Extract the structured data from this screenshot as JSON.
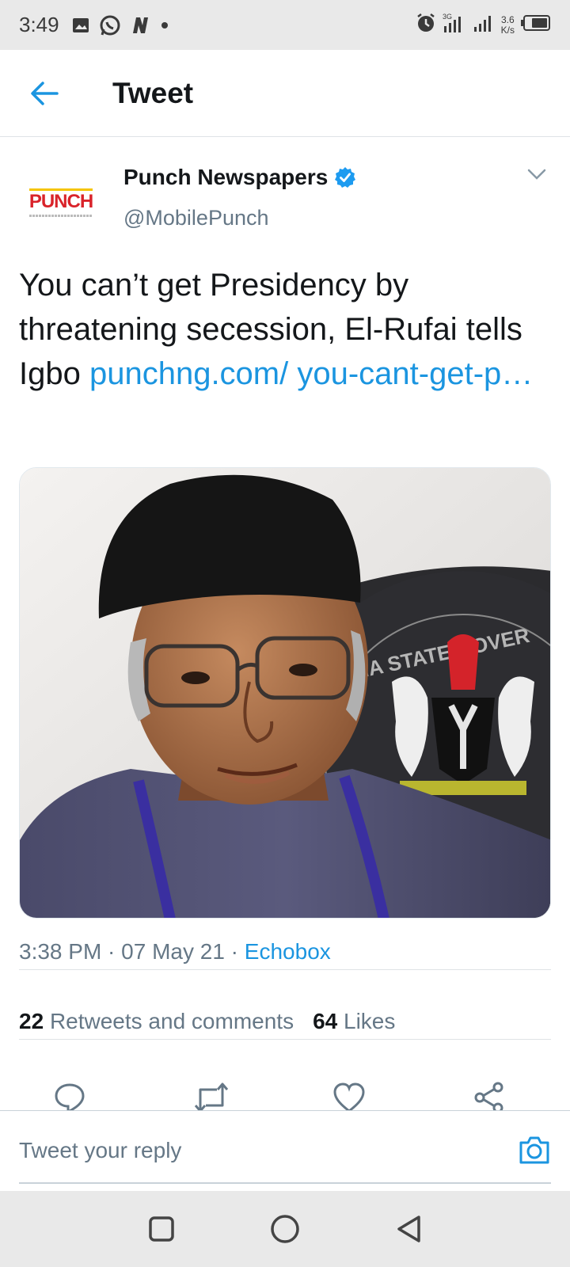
{
  "status_bar": {
    "time": "3:49",
    "net_speed_value": "3.6",
    "net_speed_unit": "K/s",
    "icons": [
      "image-icon",
      "whatsapp-icon",
      "n-app-icon",
      "dot-icon",
      "alarm-icon",
      "signal-3g-icon",
      "signal-icon",
      "battery-icon"
    ]
  },
  "header": {
    "title": "Tweet"
  },
  "tweet": {
    "author_name": "Punch Newspapers",
    "author_handle": "@MobilePunch",
    "avatar_logo": "PUNCH",
    "text": "You can’t get Presidency by threatening secession, El-Rufai tells Igbo ",
    "link_text": "punchng.com/ you-cant-get-p…",
    "timestamp": "3:38 PM · 07 May 21 · ",
    "source": "Echobox",
    "retweets_count": "22",
    "retweets_label": "Retweets and comments",
    "likes_count": "64",
    "likes_label": "Likes"
  },
  "media": {
    "seal_text": "NA STATE GOVER"
  },
  "reply": {
    "placeholder": "Tweet your reply"
  },
  "colors": {
    "accent": "#1b95e0",
    "secondary_text": "#657786",
    "primary_text": "#14171a",
    "punch_red": "#d9232a"
  }
}
